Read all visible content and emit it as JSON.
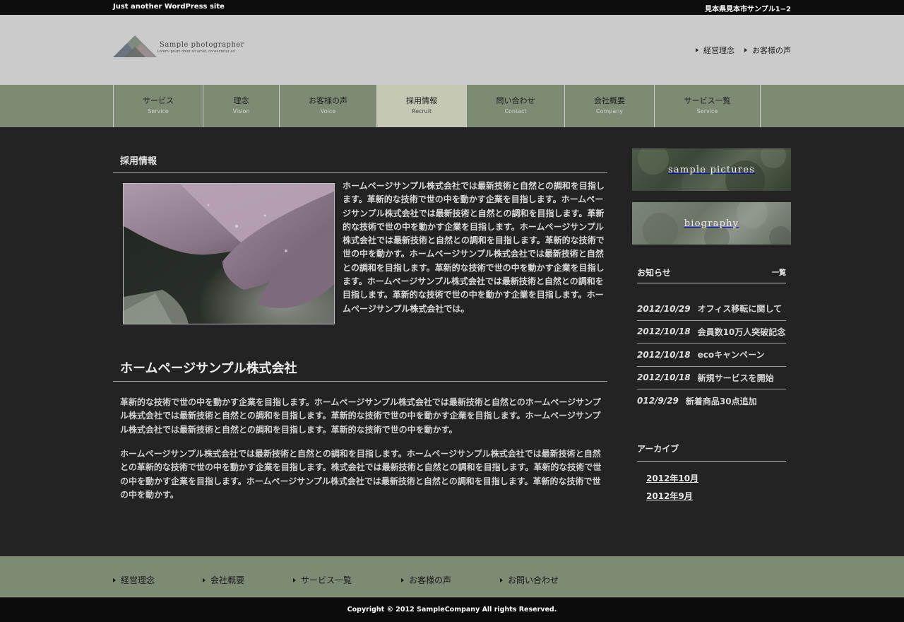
{
  "topbar": {
    "tagline": "Just another WordPress site",
    "address": "見本県見本市サンプル1−2"
  },
  "logo": {
    "name": "Sample photographer",
    "subtitle": "Lorem ipsum dolor sit amet, consectetur ad"
  },
  "header_links": [
    "経営理念",
    "お客様の声"
  ],
  "nav": [
    {
      "jp": "サービス",
      "en": "Service"
    },
    {
      "jp": "理念",
      "en": "Vision"
    },
    {
      "jp": "お客様の声",
      "en": "Voice"
    },
    {
      "jp": "採用情報",
      "en": "Recruit"
    },
    {
      "jp": "問い合わせ",
      "en": "Contact"
    },
    {
      "jp": "会社概要",
      "en": "Company"
    },
    {
      "jp": "サービス一覧",
      "en": "Service"
    }
  ],
  "main": {
    "page_title": "採用情報",
    "intro": "ホームページサンプル株式会社では最新技術と自然との調和を目指します。革新的な技術で世の中を動かす企業を目指します。ホームページサンプル株式会社では最新技術と自然との調和を目指します。革新的な技術で世の中を動かす企業を目指します。ホームページサンプル株式会社では最新技術と自然との調和を目指します。革新的な技術で世の中を動かす。ホームページサンプル株式会社では最新技術と自然との調和を目指します。革新的な技術で世の中を動かす企業を目指します。ホームページサンプル株式会社では最新技術と自然との調和を目指します。革新的な技術で世の中を動かす企業を目指します。ホームページサンプル株式会社では。",
    "company_heading": "ホームページサンプル株式会社",
    "paragraph1": "革新的な技術で世の中を動かす企業を目指します。ホームページサンプル株式会社では最新技術と自然とのホームページサンプル株式会社では最新技術と自然との調和を目指します。革新的な技術で世の中を動かす企業を目指します。ホームページサンプル株式会社では最新技術と自然との調和を目指します。革新的な技術で世の中を動かす。",
    "paragraph2": "ホームページサンプル株式会社では最新技術と自然との調和を目指します。ホームページサンプル株式会社では最新技術と自然との革新的な技術で世の中を動かす企業を目指します。株式会社では最新技術と自然との調和を目指します。革新的な技術で世の中を動かす企業を目指します。ホームページサンプル株式会社では最新技術と自然との調和を目指します。革新的な技術で世の中を動かす。"
  },
  "sidebar": {
    "banner1": "sample pictures",
    "banner2": "biography",
    "news_title": "お知らせ",
    "news_all": "一覧",
    "news": [
      {
        "date": "2012/10/29",
        "title": "オフィス移転に関して"
      },
      {
        "date": "2012/10/18",
        "title": "会員数10万人突破記念"
      },
      {
        "date": "2012/10/18",
        "title": "ecoキャンペーン"
      },
      {
        "date": "2012/10/18",
        "title": "新規サービスを開始"
      },
      {
        "date": "012/9/29",
        "title": "新着商品30点追加"
      }
    ],
    "archive_title": "アーカイブ",
    "archives": [
      "2012年10月",
      "2012年9月"
    ]
  },
  "footer_links": [
    "経営理念",
    "会社概要",
    "サービス一覧",
    "お客様の声",
    "お問い合わせ"
  ],
  "copyright": "Copyright © 2012 SampleCompany All rights Reserved.",
  "colors": {
    "body_bg": "#232323",
    "nav_bg": "#7d8a74",
    "nav_active": "#c6c8b6",
    "header_bg": "#cbcbcb"
  }
}
